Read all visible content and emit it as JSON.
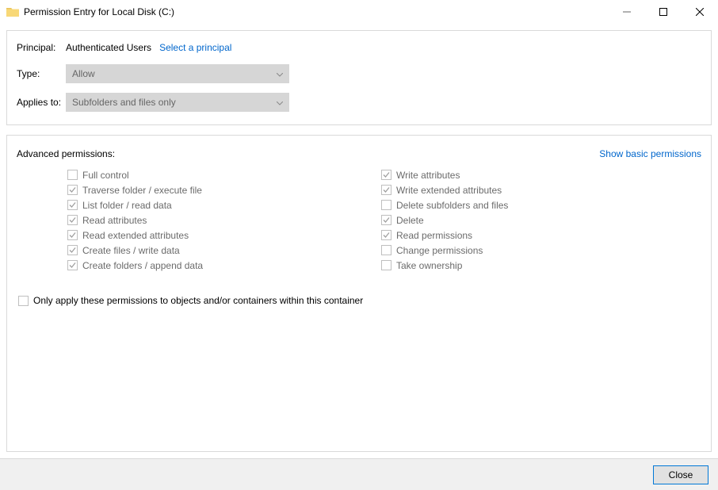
{
  "window": {
    "title": "Permission Entry for Local Disk (C:)"
  },
  "principal": {
    "label": "Principal:",
    "value": "Authenticated Users",
    "select_link": "Select a principal"
  },
  "type": {
    "label": "Type:",
    "value": "Allow"
  },
  "applies_to": {
    "label": "Applies to:",
    "value": "Subfolders and files only"
  },
  "permissions": {
    "section_title": "Advanced permissions:",
    "show_basic_link": "Show basic permissions",
    "left": [
      {
        "label": "Full control",
        "checked": false
      },
      {
        "label": "Traverse folder / execute file",
        "checked": true
      },
      {
        "label": "List folder / read data",
        "checked": true
      },
      {
        "label": "Read attributes",
        "checked": true
      },
      {
        "label": "Read extended attributes",
        "checked": true
      },
      {
        "label": "Create files / write data",
        "checked": true
      },
      {
        "label": "Create folders / append data",
        "checked": true
      }
    ],
    "right": [
      {
        "label": "Write attributes",
        "checked": true
      },
      {
        "label": "Write extended attributes",
        "checked": true
      },
      {
        "label": "Delete subfolders and files",
        "checked": false
      },
      {
        "label": "Delete",
        "checked": true
      },
      {
        "label": "Read permissions",
        "checked": true
      },
      {
        "label": "Change permissions",
        "checked": false
      },
      {
        "label": "Take ownership",
        "checked": false
      }
    ]
  },
  "only_apply": {
    "label": "Only apply these permissions to objects and/or containers within this container",
    "checked": false
  },
  "footer": {
    "close": "Close"
  }
}
